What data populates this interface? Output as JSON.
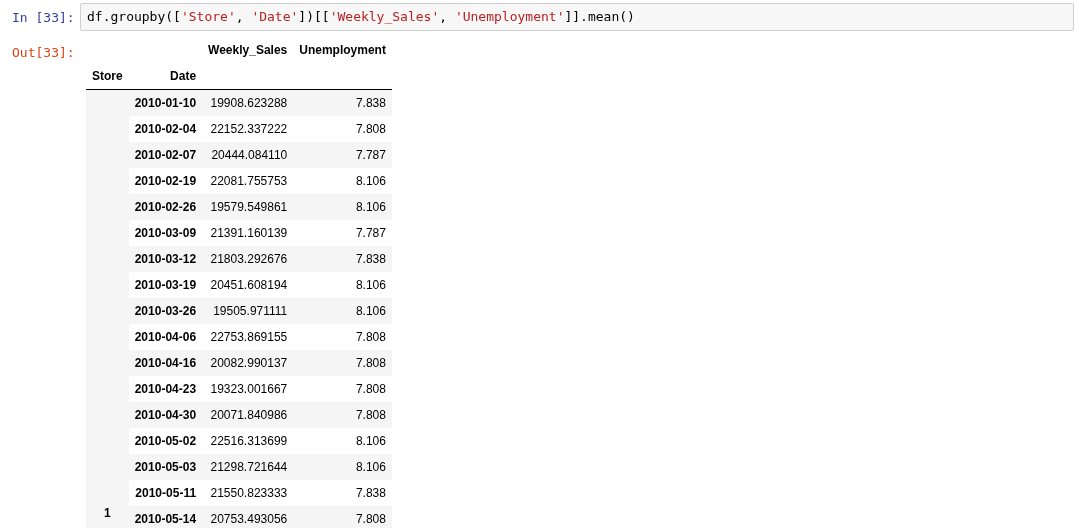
{
  "input_cell": {
    "prompt": "In [33]:",
    "code": [
      {
        "kind": "plain",
        "text": "df.groupby(["
      },
      {
        "kind": "string",
        "text": "'Store'"
      },
      {
        "kind": "plain",
        "text": ", "
      },
      {
        "kind": "string",
        "text": "'Date'"
      },
      {
        "kind": "plain",
        "text": "])[["
      },
      {
        "kind": "string",
        "text": "'Weekly_Sales'"
      },
      {
        "kind": "plain",
        "text": ", "
      },
      {
        "kind": "string",
        "text": "'Unemployment'"
      },
      {
        "kind": "plain",
        "text": "]].mean()"
      }
    ]
  },
  "output_cell": {
    "prompt": "Out[33]:",
    "table": {
      "columns": [
        "Weekly_Sales",
        "Unemployment"
      ],
      "index_names": [
        "Store",
        "Date"
      ],
      "store": "1",
      "rows": [
        {
          "date": "2010-01-10",
          "weekly_sales": "19908.623288",
          "unemployment": "7.838"
        },
        {
          "date": "2010-02-04",
          "weekly_sales": "22152.337222",
          "unemployment": "7.808"
        },
        {
          "date": "2010-02-07",
          "weekly_sales": "20444.084110",
          "unemployment": "7.787"
        },
        {
          "date": "2010-02-19",
          "weekly_sales": "22081.755753",
          "unemployment": "8.106"
        },
        {
          "date": "2010-02-26",
          "weekly_sales": "19579.549861",
          "unemployment": "8.106"
        },
        {
          "date": "2010-03-09",
          "weekly_sales": "21391.160139",
          "unemployment": "7.787"
        },
        {
          "date": "2010-03-12",
          "weekly_sales": "21803.292676",
          "unemployment": "7.838"
        },
        {
          "date": "2010-03-19",
          "weekly_sales": "20451.608194",
          "unemployment": "8.106"
        },
        {
          "date": "2010-03-26",
          "weekly_sales": "19505.971111",
          "unemployment": "8.106"
        },
        {
          "date": "2010-04-06",
          "weekly_sales": "22753.869155",
          "unemployment": "7.808"
        },
        {
          "date": "2010-04-16",
          "weekly_sales": "20082.990137",
          "unemployment": "7.808"
        },
        {
          "date": "2010-04-23",
          "weekly_sales": "19323.001667",
          "unemployment": "7.808"
        },
        {
          "date": "2010-04-30",
          "weekly_sales": "20071.840986",
          "unemployment": "7.808"
        },
        {
          "date": "2010-05-02",
          "weekly_sales": "22516.313699",
          "unemployment": "8.106"
        },
        {
          "date": "2010-05-03",
          "weekly_sales": "21298.721644",
          "unemployment": "8.106"
        },
        {
          "date": "2010-05-11",
          "weekly_sales": "21550.823333",
          "unemployment": "7.838"
        },
        {
          "date": "2010-05-14",
          "weekly_sales": "20753.493056",
          "unemployment": "7.808"
        }
      ]
    }
  }
}
